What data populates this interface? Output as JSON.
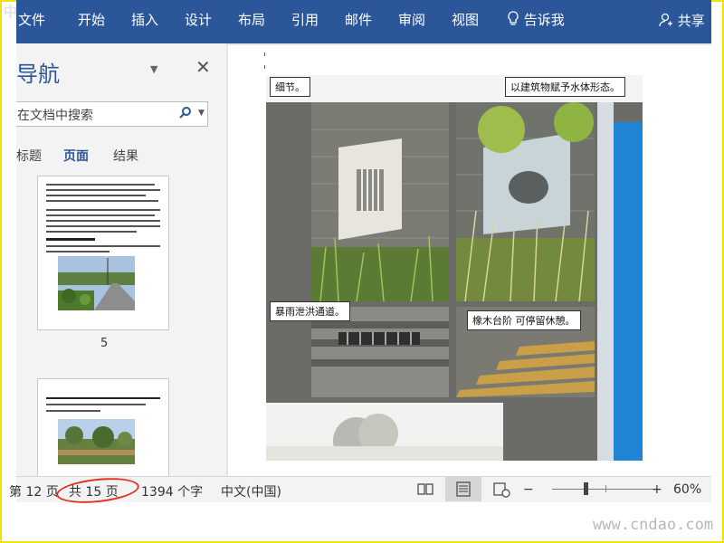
{
  "watermark": {
    "top": "中国道桥网",
    "bottom": "www.cndao.com"
  },
  "ribbon": {
    "tabs": [
      "文件",
      "开始",
      "插入",
      "设计",
      "布局",
      "引用",
      "邮件",
      "审阅",
      "视图"
    ],
    "tell_me": "告诉我",
    "share": "共享",
    "color": "#2b579a"
  },
  "nav_pane": {
    "title": "导航",
    "search_placeholder": "在文档中搜索",
    "tabs": [
      {
        "label": "标题",
        "active": false
      },
      {
        "label": "页面",
        "active": true
      },
      {
        "label": "结果",
        "active": false
      }
    ],
    "page_number": "5"
  },
  "document": {
    "captions": {
      "detail": "细节。",
      "form": "以建筑物赋予水体形态。",
      "stormwater": "暴雨泄洪通道。",
      "steps": "橡木台阶 可停留休憩。"
    }
  },
  "status_bar": {
    "page": "第 12 页",
    "total_pages": "共 15 页",
    "word_count": "1394 个字",
    "language": "中文(中国)",
    "zoom_minus": "−",
    "zoom_plus": "+",
    "zoom": "60%",
    "zoom_value": 60,
    "highlight_color": "#e0301e"
  }
}
